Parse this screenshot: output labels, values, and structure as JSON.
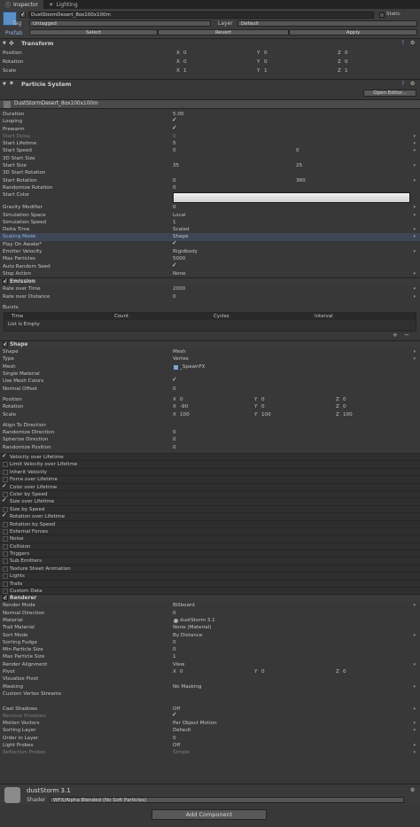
{
  "tabs": [
    {
      "label": "Inspector"
    },
    {
      "label": "Lighting"
    }
  ],
  "object": {
    "name": "DustStormDesert_8ox100x100m",
    "static_label": "Static",
    "tag_label": "Tag",
    "tag_value": "Untagged",
    "layer_label": "Layer",
    "layer_value": "Default",
    "prefab_label": "Prefab",
    "select_label": "Select",
    "revert_label": "Revert",
    "apply_label": "Apply"
  },
  "transform": {
    "title": "Transform",
    "rows": [
      {
        "label": "Position",
        "x": "0",
        "y": "0",
        "z": "0"
      },
      {
        "label": "Rotation",
        "x": "0",
        "y": "0",
        "z": "0"
      },
      {
        "label": "Scale",
        "x": "1",
        "y": "1",
        "z": "1"
      }
    ]
  },
  "particle": {
    "title": "Particle System",
    "open_editor": "Open Editor...",
    "system_name": "DustStormDesert_8ox100x100m",
    "main_rows": [
      {
        "label": "Duration",
        "value": "5.00"
      },
      {
        "label": "Looping",
        "value": "",
        "check": true
      },
      {
        "label": "Prewarm",
        "value": "",
        "check": true
      },
      {
        "label": "Start Delay",
        "value": "0",
        "dim": true
      },
      {
        "label": "Start Lifetime",
        "value": "5"
      },
      {
        "label": "Start Speed",
        "value": "0",
        "value2": "0"
      },
      {
        "label": "3D Start Size",
        "value": ""
      },
      {
        "label": "Start Size",
        "value": "35",
        "value2": "25"
      },
      {
        "label": "3D Start Rotation",
        "value": ""
      },
      {
        "label": "Start Rotation",
        "value": "0",
        "value2": "360"
      },
      {
        "label": "Randomize Rotation",
        "value": "0"
      },
      {
        "label": "Start Color",
        "value": ""
      },
      {
        "label": "Gravity Modifier",
        "value": "0"
      },
      {
        "label": "Simulation Space",
        "value": "Local"
      },
      {
        "label": "Simulation Speed",
        "value": "1"
      },
      {
        "label": "Delta Time",
        "value": "Scaled"
      },
      {
        "label": "Scaling Mode",
        "value": "Shape",
        "hl": true
      },
      {
        "label": "Play On Awake*",
        "value": "",
        "check": true
      },
      {
        "label": "Emitter Velocity",
        "value": "Rigidbody"
      },
      {
        "label": "Max Particles",
        "value": "5000"
      },
      {
        "label": "Auto Random Seed",
        "value": "",
        "check": true
      },
      {
        "label": "Stop Action",
        "value": "None"
      }
    ],
    "emission": {
      "title": "Emission",
      "rows": [
        {
          "label": "Rate over Time",
          "value": "2000"
        },
        {
          "label": "Rate over Distance",
          "value": "0"
        }
      ],
      "bursts_label": "Bursts",
      "columns": [
        "Time",
        "Count",
        "Cycles",
        "Interval"
      ],
      "empty_label": "List is Empty",
      "add": "+",
      "remove": "−"
    },
    "shape": {
      "title": "Shape",
      "rows": [
        {
          "label": "Shape",
          "value": "Mesh"
        },
        {
          "label": "Type",
          "value": "Vertex"
        },
        {
          "label": "Mesh",
          "value": "_SpawnFX"
        },
        {
          "label": "Single Material",
          "value": ""
        },
        {
          "label": "Use Mesh Colors",
          "value": "",
          "check": true
        },
        {
          "label": "Normal Offset",
          "value": "0"
        }
      ],
      "xyz_rows": [
        {
          "label": "Position",
          "x": "0",
          "y": "0",
          "z": "0"
        },
        {
          "label": "Rotation",
          "x": "-90",
          "y": "0",
          "z": "0"
        },
        {
          "label": "Scale",
          "x": "100",
          "y": "100",
          "z": "100"
        }
      ],
      "rows2": [
        {
          "label": "Align To Direction",
          "value": ""
        },
        {
          "label": "Randomize Direction",
          "value": "0"
        },
        {
          "label": "Spherize Direction",
          "value": "0"
        },
        {
          "label": "Randomize Position",
          "value": "0"
        }
      ]
    },
    "modules": [
      {
        "label": "Velocity over Lifetime",
        "on": true
      },
      {
        "label": "Limit Velocity over Lifetime",
        "on": false
      },
      {
        "label": "Inherit Velocity",
        "on": false
      },
      {
        "label": "Force over Lifetime",
        "on": false
      },
      {
        "label": "Color over Lifetime",
        "on": true
      },
      {
        "label": "Color by Speed",
        "on": false
      },
      {
        "label": "Size over Lifetime",
        "on": true
      },
      {
        "label": "Size by Speed",
        "on": false
      },
      {
        "label": "Rotation over Lifetime",
        "on": true
      },
      {
        "label": "Rotation by Speed",
        "on": false
      },
      {
        "label": "External Forces",
        "on": false
      },
      {
        "label": "Noise",
        "on": false
      },
      {
        "label": "Collision",
        "on": false
      },
      {
        "label": "Triggers",
        "on": false
      },
      {
        "label": "Sub Emitters",
        "on": false
      },
      {
        "label": "Texture Sheet Animation",
        "on": false
      },
      {
        "label": "Lights",
        "on": false
      },
      {
        "label": "Trails",
        "on": false
      },
      {
        "label": "Custom Data",
        "on": false
      }
    ],
    "renderer": {
      "title": "Renderer",
      "rows": [
        {
          "label": "Render Mode",
          "value": "Billboard"
        },
        {
          "label": "Normal Direction",
          "value": "0"
        },
        {
          "label": "Material",
          "value": "dustStorm 3.1"
        },
        {
          "label": "Trail Material",
          "value": "None (Material)"
        },
        {
          "label": "Sort Mode",
          "value": "By Distance"
        },
        {
          "label": "Sorting Fudge",
          "value": "0"
        },
        {
          "label": "Min Particle Size",
          "value": "0"
        },
        {
          "label": "Max Particle Size",
          "value": "1"
        },
        {
          "label": "Render Alignment",
          "value": "View"
        }
      ],
      "pivot": {
        "label": "Pivot",
        "x": "0",
        "y": "0",
        "z": "0"
      },
      "rows2": [
        {
          "label": "Visualize Pivot",
          "value": ""
        },
        {
          "label": "Masking",
          "value": "No Masking"
        },
        {
          "label": "Custom Vertex Streams",
          "value": ""
        },
        {
          "label": "",
          "value": ""
        },
        {
          "label": "Cast Shadows",
          "value": "Off"
        },
        {
          "label": "Receive Shadows",
          "value": "",
          "check": true,
          "dim": true
        },
        {
          "label": "Motion Vectors",
          "value": "Per Object Motion"
        },
        {
          "label": "Sorting Layer",
          "value": "Default"
        },
        {
          "label": "Order in Layer",
          "value": "0"
        },
        {
          "label": "Light Probes",
          "value": "Off"
        },
        {
          "label": "Reflection Probes",
          "value": "Simple",
          "dim": true
        }
      ]
    }
  },
  "material": {
    "name": "dustStorm 3.1",
    "shader_label": "Shader",
    "shader_value": "WFX/Alpha Blended (No Soft Particles)"
  },
  "add_component": "Add Component"
}
